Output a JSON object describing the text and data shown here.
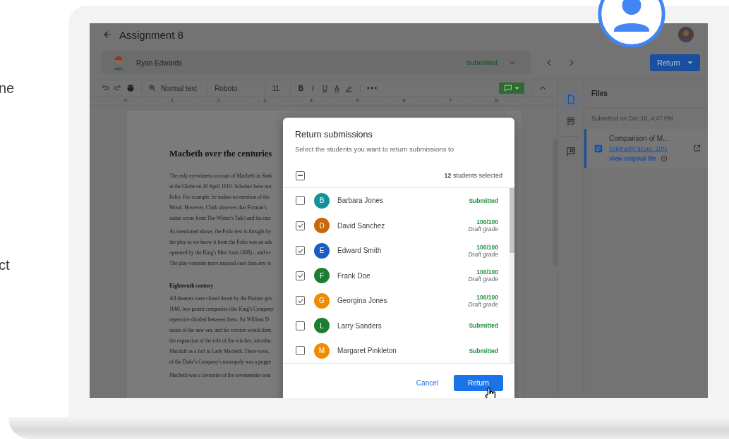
{
  "side_text": [
    "ne",
    "ct"
  ],
  "header": {
    "title": "Assignment 8"
  },
  "student_bar": {
    "name": "Ryan Edwards",
    "status": "Submitted"
  },
  "return_button": {
    "label": "Return"
  },
  "toolbar": {
    "style": "Normal text",
    "font": "Roboto",
    "size": "11",
    "format": [
      "B",
      "I",
      "U",
      "A"
    ]
  },
  "ruler": [
    "0",
    "1",
    "2",
    "3",
    "4",
    "5",
    "6",
    "7",
    "8"
  ],
  "document": [
    {
      "kind": "title",
      "lines": [
        "Macbeth over the centuries"
      ]
    },
    {
      "kind": "paragraph",
      "lines": [
        "The only eyewitness account of Macbeth in Shak",
        "at the Globe on 20 April 1610. Scholars have not",
        "Folio. For example, he makes no mention of the",
        "Wood. However, Clark observes that Forman's",
        "statue scene from The Winter's Tale) and his inte"
      ]
    },
    {
      "kind": "paragraph",
      "lines": [
        "As mentioned above, the Folio text is thought by",
        "the play as we know it from the Folio was an ada",
        "operated by the King's Men from 1608) – and ev",
        "The play contains more musical cues than any ot"
      ]
    },
    {
      "kind": "heading",
      "lines": [
        "Eighteenth century"
      ]
    },
    {
      "kind": "paragraph",
      "lines": [
        "All theatres were closed down by the Puritan gov",
        "1660, two patent companies (the King's Company",
        "repertoire divided between them.  Sir William D",
        "tastes of the new era, and his version would dom",
        "the expansion of the role of the witches, introduc",
        "Macduff as a foil to Lady Macbeth. There were,",
        "of the Duke's Company's monopoly was a puppe"
      ]
    },
    {
      "kind": "paragraph",
      "lines": [
        "Macbeth was a favourite of the seventeenth-cent"
      ]
    }
  ],
  "files_panel": {
    "title": "Files",
    "submitted": "Submitted on Dec 16, 4:47 PM",
    "file": {
      "name": "Comparison of M...",
      "originality": "Originality score: 10%",
      "view": "View original file"
    }
  },
  "dialog": {
    "title": "Return submissions",
    "subtitle": "Select the students you want to return submissions to",
    "select_all_indeterminate": true,
    "count": "**12** students selected",
    "students": [
      {
        "initial": "B",
        "name": "Barbara Jones",
        "color": "#12939a",
        "checked": false,
        "kind": "status",
        "status": "Submitted"
      },
      {
        "initial": "D",
        "name": "David Sanchez",
        "color": "#c8680c",
        "checked": true,
        "kind": "grade",
        "grade": "100/100",
        "note": "Draft grade"
      },
      {
        "initial": "E",
        "name": "Edward Smith",
        "color": "#1a5bc4",
        "checked": true,
        "kind": "grade",
        "grade": "100/100",
        "note": "Draft grade"
      },
      {
        "initial": "F",
        "name": "Frank Doe",
        "color": "#1e7d32",
        "checked": true,
        "kind": "grade",
        "grade": "100/100",
        "note": "Draft grade"
      },
      {
        "initial": "G",
        "name": "Georgina Jones",
        "color": "#f08c00",
        "checked": true,
        "kind": "grade",
        "grade": "100/100",
        "note": "Draft grade"
      },
      {
        "initial": "L",
        "name": "Larry Sanders",
        "color": "#1e7d32",
        "checked": false,
        "kind": "status",
        "status": "Submitted"
      },
      {
        "initial": "M",
        "name": "Margaret Pinkleton",
        "color": "#f08c00",
        "checked": false,
        "kind": "status",
        "status": "Submitted"
      }
    ],
    "cancel": "Cancel",
    "confirm": "Return"
  }
}
